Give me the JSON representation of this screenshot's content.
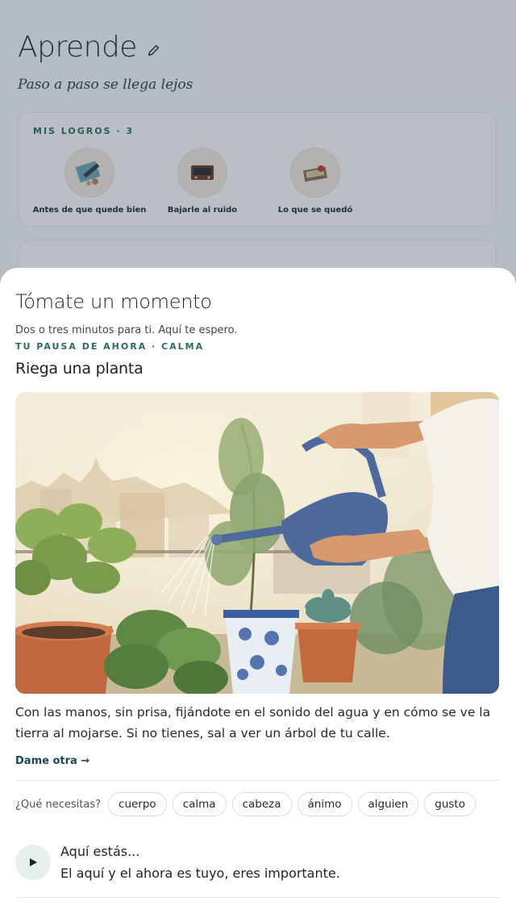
{
  "page": {
    "title": "Aprende",
    "subtitle": "Paso a paso se llega lejos",
    "achievements_label": "MIS LOGROS · 3",
    "achievements": [
      {
        "label": "Antes de que quede bien",
        "icon": "drawing-tools-icon"
      },
      {
        "label": "Bajarle al ruido",
        "icon": "radio-icon"
      },
      {
        "label": "Lo que se quedó",
        "icon": "keepsake-box-icon"
      }
    ]
  },
  "sheet": {
    "title": "Tómate un momento",
    "subtitle": "Dos o tres minutos para ti. Aquí te espero.",
    "tag": "TU PAUSA DE AHORA · CALMA",
    "activity_title": "Riega una planta",
    "description": "Con las manos, sin prisa, fijándote en el sonido del agua y en cómo se ve la tierra al mojarse. Si no tienes, sal a ver un árbol de tu calle.",
    "another_label": "Dame otra →",
    "needs_question": "¿Qué necesitas?",
    "needs": [
      "cuerpo",
      "calma",
      "cabeza",
      "ánimo",
      "alguien",
      "gusto"
    ],
    "player": {
      "line1": "Aquí estás...",
      "line2": "El aquí y el ahora es tuyo, eres importante."
    }
  },
  "colors": {
    "accent": "#2b6b66",
    "overlay": "#28374b"
  }
}
